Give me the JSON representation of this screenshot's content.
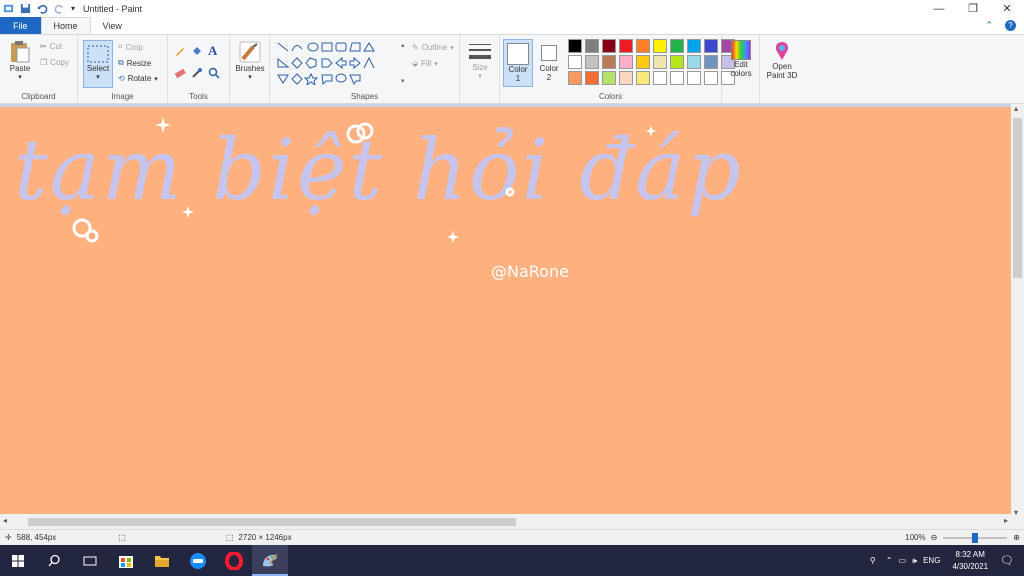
{
  "window": {
    "title": "Untitled - Paint",
    "controls": {
      "minimize": "—",
      "restore": "❐",
      "close": "✕"
    }
  },
  "tabs": [
    {
      "label": "File"
    },
    {
      "label": "Home"
    },
    {
      "label": "View"
    }
  ],
  "ribbon": {
    "clipboard": {
      "paste": "Paste",
      "cut": "Cut",
      "copy": "Copy",
      "group": "Clipboard"
    },
    "image": {
      "select": "Select",
      "crop": "Crop",
      "resize": "Resize",
      "rotate": "Rotate",
      "group": "Image"
    },
    "tools": {
      "group": "Tools"
    },
    "brushes": {
      "label": "Brushes"
    },
    "shapes": {
      "outline": "Outline",
      "fill": "Fill",
      "group": "Shapes"
    },
    "size": {
      "label": "Size"
    },
    "color1": {
      "label": "Color",
      "num": "1"
    },
    "color2": {
      "label": "Color",
      "num": "2"
    },
    "colors": {
      "group": "Colors",
      "edit_line1": "Edit",
      "edit_line2": "colors"
    },
    "paint3d": {
      "line1": "Open",
      "line2": "Paint 3D"
    },
    "palette_row1": [
      "#000000",
      "#7f7f7f",
      "#880015",
      "#ed1c24",
      "#ff7f27",
      "#fff200",
      "#22b14c",
      "#00a2e8",
      "#3f48cc",
      "#a349a4"
    ],
    "palette_row2": [
      "#ffffff",
      "#c3c3c3",
      "#b97a57",
      "#ffaec9",
      "#ffc90e",
      "#efe4b0",
      "#b5e61d",
      "#99d9ea",
      "#7092be",
      "#c8bfe7"
    ],
    "palette_row3": [
      "#f89a5e",
      "#f26f36",
      "#b4e16c",
      "#fbd6c0",
      "#f8e77b",
      "#ffffff",
      "#ffffff",
      "#ffffff",
      "#ffffff",
      "#ffffff"
    ]
  },
  "canvas": {
    "background": "#feb17e",
    "headline": "tạm biệt hỏi đáp",
    "headline_color": "#c6c4ec",
    "watermark": "@NaRone"
  },
  "status": {
    "cursor": "588, 454px",
    "dimensions": "2720 × 1246px",
    "zoom": "100%"
  },
  "taskbar": {
    "lang": "ENG",
    "time": "8:32 AM",
    "date": "4/30/2021"
  }
}
